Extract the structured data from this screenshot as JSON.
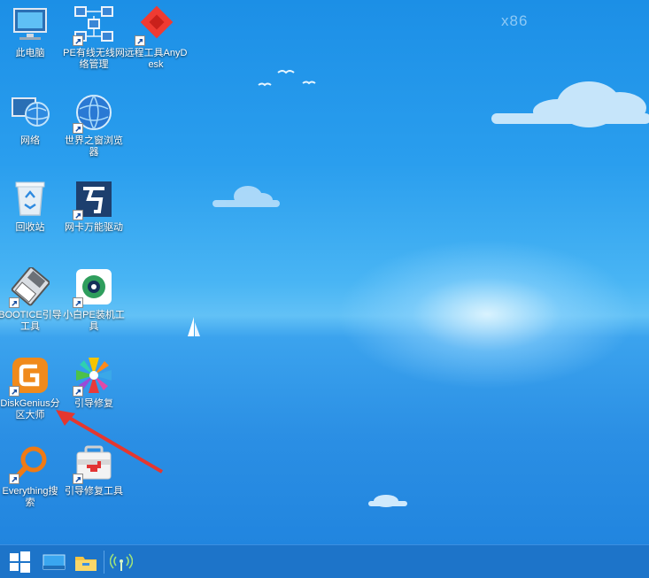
{
  "watermark": "x86",
  "desktop_icons": [
    {
      "label": "此电脑",
      "icon": "computer-icon"
    },
    {
      "label": "PE有线无线网络管理",
      "icon": "network-manager-icon"
    },
    {
      "label": "远程工具AnyDesk",
      "icon": "anydesk-icon"
    },
    {
      "label": "网络",
      "icon": "network-globe-icon"
    },
    {
      "label": "世界之窗浏览器",
      "icon": "browser-globe-icon"
    },
    {
      "label": "回收站",
      "icon": "recycle-bin-icon"
    },
    {
      "label": "网卡万能驱动",
      "icon": "wan-driver-icon"
    },
    {
      "label": "BOOTICE引导工具",
      "icon": "bootice-icon"
    },
    {
      "label": "小白PE装机工具",
      "icon": "xiaobai-installer-icon"
    },
    {
      "label": "DiskGenius分区大师",
      "icon": "diskgenius-icon"
    },
    {
      "label": "引导修复",
      "icon": "boot-repair-icon"
    },
    {
      "label": "Everything搜索",
      "icon": "everything-search-icon"
    },
    {
      "label": "引导修复工具",
      "icon": "boot-repair-tool-icon"
    }
  ],
  "taskbar": {
    "start": "windows-start-icon",
    "items": [
      "desktop-icon",
      "file-explorer-icon"
    ],
    "tray": [
      "wireless-signal-icon"
    ]
  },
  "annotation": {
    "type": "red-arrow",
    "points_to": "DiskGenius分区大师"
  }
}
